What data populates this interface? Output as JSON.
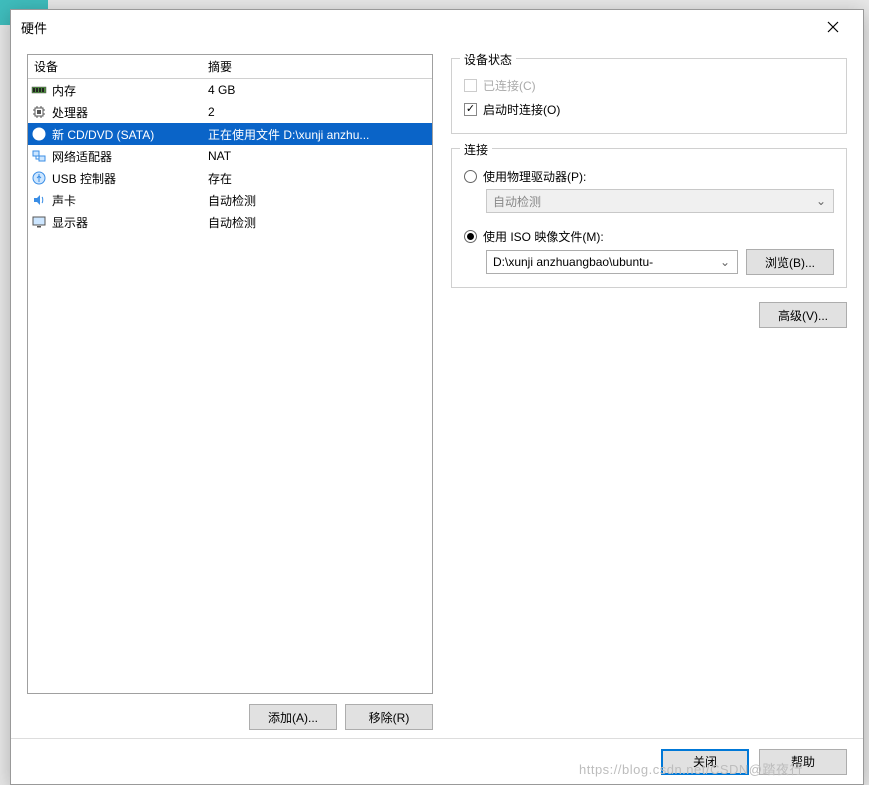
{
  "window": {
    "title": "硬件"
  },
  "table": {
    "header_device": "设备",
    "header_summary": "摘要",
    "rows": [
      {
        "icon": "memory-icon",
        "name": "内存",
        "summary": "4 GB",
        "selected": false
      },
      {
        "icon": "cpu-icon",
        "name": "处理器",
        "summary": "2",
        "selected": false
      },
      {
        "icon": "cd-icon",
        "name": "新 CD/DVD (SATA)",
        "summary": "正在使用文件 D:\\xunji anzhu...",
        "selected": true
      },
      {
        "icon": "network-icon",
        "name": "网络适配器",
        "summary": "NAT",
        "selected": false
      },
      {
        "icon": "usb-icon",
        "name": "USB 控制器",
        "summary": "存在",
        "selected": false
      },
      {
        "icon": "sound-icon",
        "name": "声卡",
        "summary": "自动检测",
        "selected": false
      },
      {
        "icon": "display-icon",
        "name": "显示器",
        "summary": "自动检测",
        "selected": false
      }
    ]
  },
  "buttons": {
    "add": "添加(A)...",
    "remove": "移除(R)",
    "browse": "浏览(B)...",
    "advanced": "高级(V)...",
    "close": "关闭",
    "help": "帮助"
  },
  "status_group": {
    "legend": "设备状态",
    "connected": {
      "label": "已连接(C)",
      "checked": false,
      "enabled": false
    },
    "connect_on_start": {
      "label": "启动时连接(O)",
      "checked": true,
      "enabled": true
    }
  },
  "connection_group": {
    "legend": "连接",
    "physical": {
      "label": "使用物理驱动器(P):",
      "selected": false,
      "combo_value": "自动检测"
    },
    "iso": {
      "label": "使用 ISO 映像文件(M):",
      "selected": true,
      "combo_value": "D:\\xunji anzhuangbao\\ubuntu-"
    }
  },
  "watermark": "https://blog.csdn.net/CSDN@踏夜行"
}
